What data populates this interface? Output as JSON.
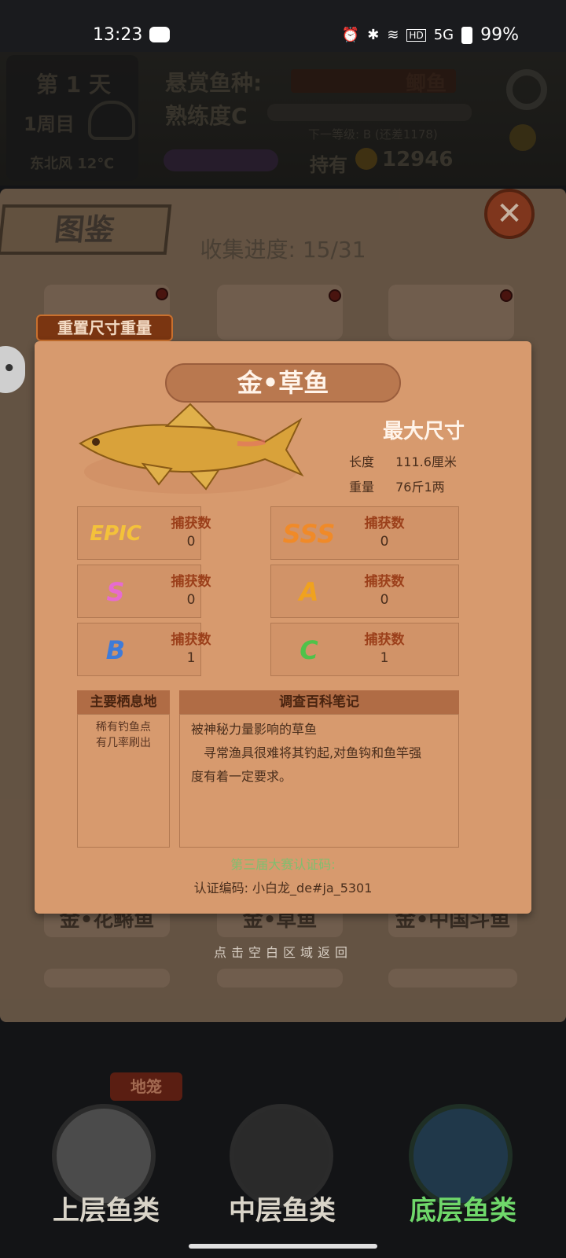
{
  "status_bar": {
    "time": "13:23",
    "battery": "99%",
    "network": "5G"
  },
  "hud": {
    "day": "第 1 天",
    "week": "1周目",
    "wind": "东北风 12℃",
    "bounty_label": "悬赏鱼种:",
    "bounty_fish": "鲫鱼",
    "proficiency": "熟练度C",
    "next_level": "下一等级: B (还差1178)",
    "hold_label": "持有",
    "coins": "12946"
  },
  "collection": {
    "title": "图鉴",
    "progress": "收集进度: 15/31",
    "close": "✕",
    "reset_button": "重置尺寸重量",
    "cards": [
      "金•花鳉鱼",
      "金•草鱼",
      "金•中国斗鱼"
    ]
  },
  "detail": {
    "fish_name": "金•草鱼",
    "max_size_title": "最大尺寸",
    "length_label": "长度",
    "length_value": "111.6厘米",
    "weight_label": "重量",
    "weight_value": "76斤1两",
    "grades": [
      {
        "badge": "EPIC",
        "label": "捕获数",
        "value": "0",
        "color": "#f4c23a"
      },
      {
        "badge": "SSS",
        "label": "捕获数",
        "value": "0",
        "color": "#f08a28"
      },
      {
        "badge": "S",
        "label": "捕获数",
        "value": "0",
        "color": "#e76bd0"
      },
      {
        "badge": "A",
        "label": "捕获数",
        "value": "0",
        "color": "#f0a21e"
      },
      {
        "badge": "B",
        "label": "捕获数",
        "value": "1",
        "color": "#3f7bd8"
      },
      {
        "badge": "C",
        "label": "捕获数",
        "value": "1",
        "color": "#4fc24a"
      }
    ],
    "habitat_title": "主要栖息地",
    "habitat_text": "稀有钓鱼点\n有几率刷出",
    "notes_title": "调查百科笔记",
    "notes_line1": "被神秘力量影响的草鱼",
    "notes_line2": "寻常渔具很难将其钓起,对鱼钩和鱼竿强",
    "notes_line3": "度有着一定要求。",
    "cert_title": "第三届大赛认证码:",
    "cert_code": "认证编码: 小白龙_de#ja_5301"
  },
  "hint": "点击空白区域返回",
  "bottom_nav": {
    "cage": "地笼",
    "upper": "上层鱼类",
    "middle": "中层鱼类",
    "bottom": "底层鱼类"
  }
}
